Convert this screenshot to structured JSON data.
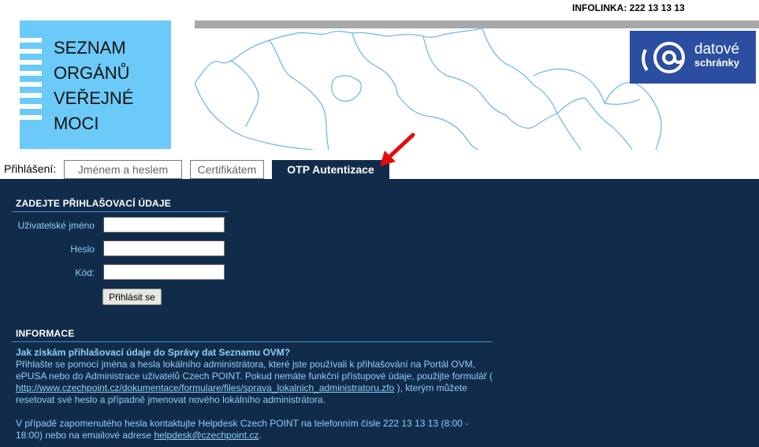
{
  "header": {
    "infolinka": "INFOLINKA: 222 13 13 13",
    "logo_lines": [
      "SEZNAM",
      "ORGÁNŮ",
      "VEŘEJNÉ",
      "MOCI"
    ],
    "ds_logo": {
      "line1": "datové",
      "line2": "schránky"
    }
  },
  "login": {
    "label": "Přihlášení:",
    "tabs": [
      {
        "label": "Jménem a heslem",
        "active": false
      },
      {
        "label": "Certifikátem",
        "active": false
      },
      {
        "label": "OTP Autentizace",
        "active": true
      }
    ]
  },
  "form": {
    "title": "ZADEJTE PŘIHLAŠOVACÍ ÚDAJE",
    "username_label": "Uživatelské jméno",
    "username_value": "",
    "password_label": "Heslo",
    "password_value": "",
    "code_label": "Kód:",
    "code_value": "",
    "submit_label": "Přihlásit se"
  },
  "info": {
    "title": "INFORMACE",
    "question": "Jak získám přihlašovací údaje do Správy dat Seznamu OVM?",
    "p1_before": "Přihlašte se pomocí jména a hesla lokálního administrátora, které jste používali k přihlašování na Portál OVM, ePUSA nebo do Administrace uživatelů Czech POINT. Pokud nemáte funkční přístupové údaje, použijte formulář ( ",
    "p1_link": "http://www.czechpoint.cz/dokumentace/formulare/files/sprava_lokalnich_administratoru.zfo",
    "p1_after": " ), kterým můžete resetovat své heslo a případně jmenovat nového lokálního administrátora.",
    "p2_before": "V případě zapomenutého hesla kontaktujte Helpdesk Czech POINT na telefonním čísle 222 13 13 13 (8:00 - 18:00) nebo na emailové adrese ",
    "p2_link": "helpdesk@czechpoint.cz",
    "p2_after": "."
  },
  "colors": {
    "panel_bg": "#112c4a",
    "logo_bg": "#6ccaf8",
    "ds_logo_bg": "#2b4ea0",
    "label_text": "#8fcff5",
    "arrow": "#e01010"
  },
  "icons": {
    "arrow": "red-arrow-icon",
    "at": "at-sign-icon"
  }
}
